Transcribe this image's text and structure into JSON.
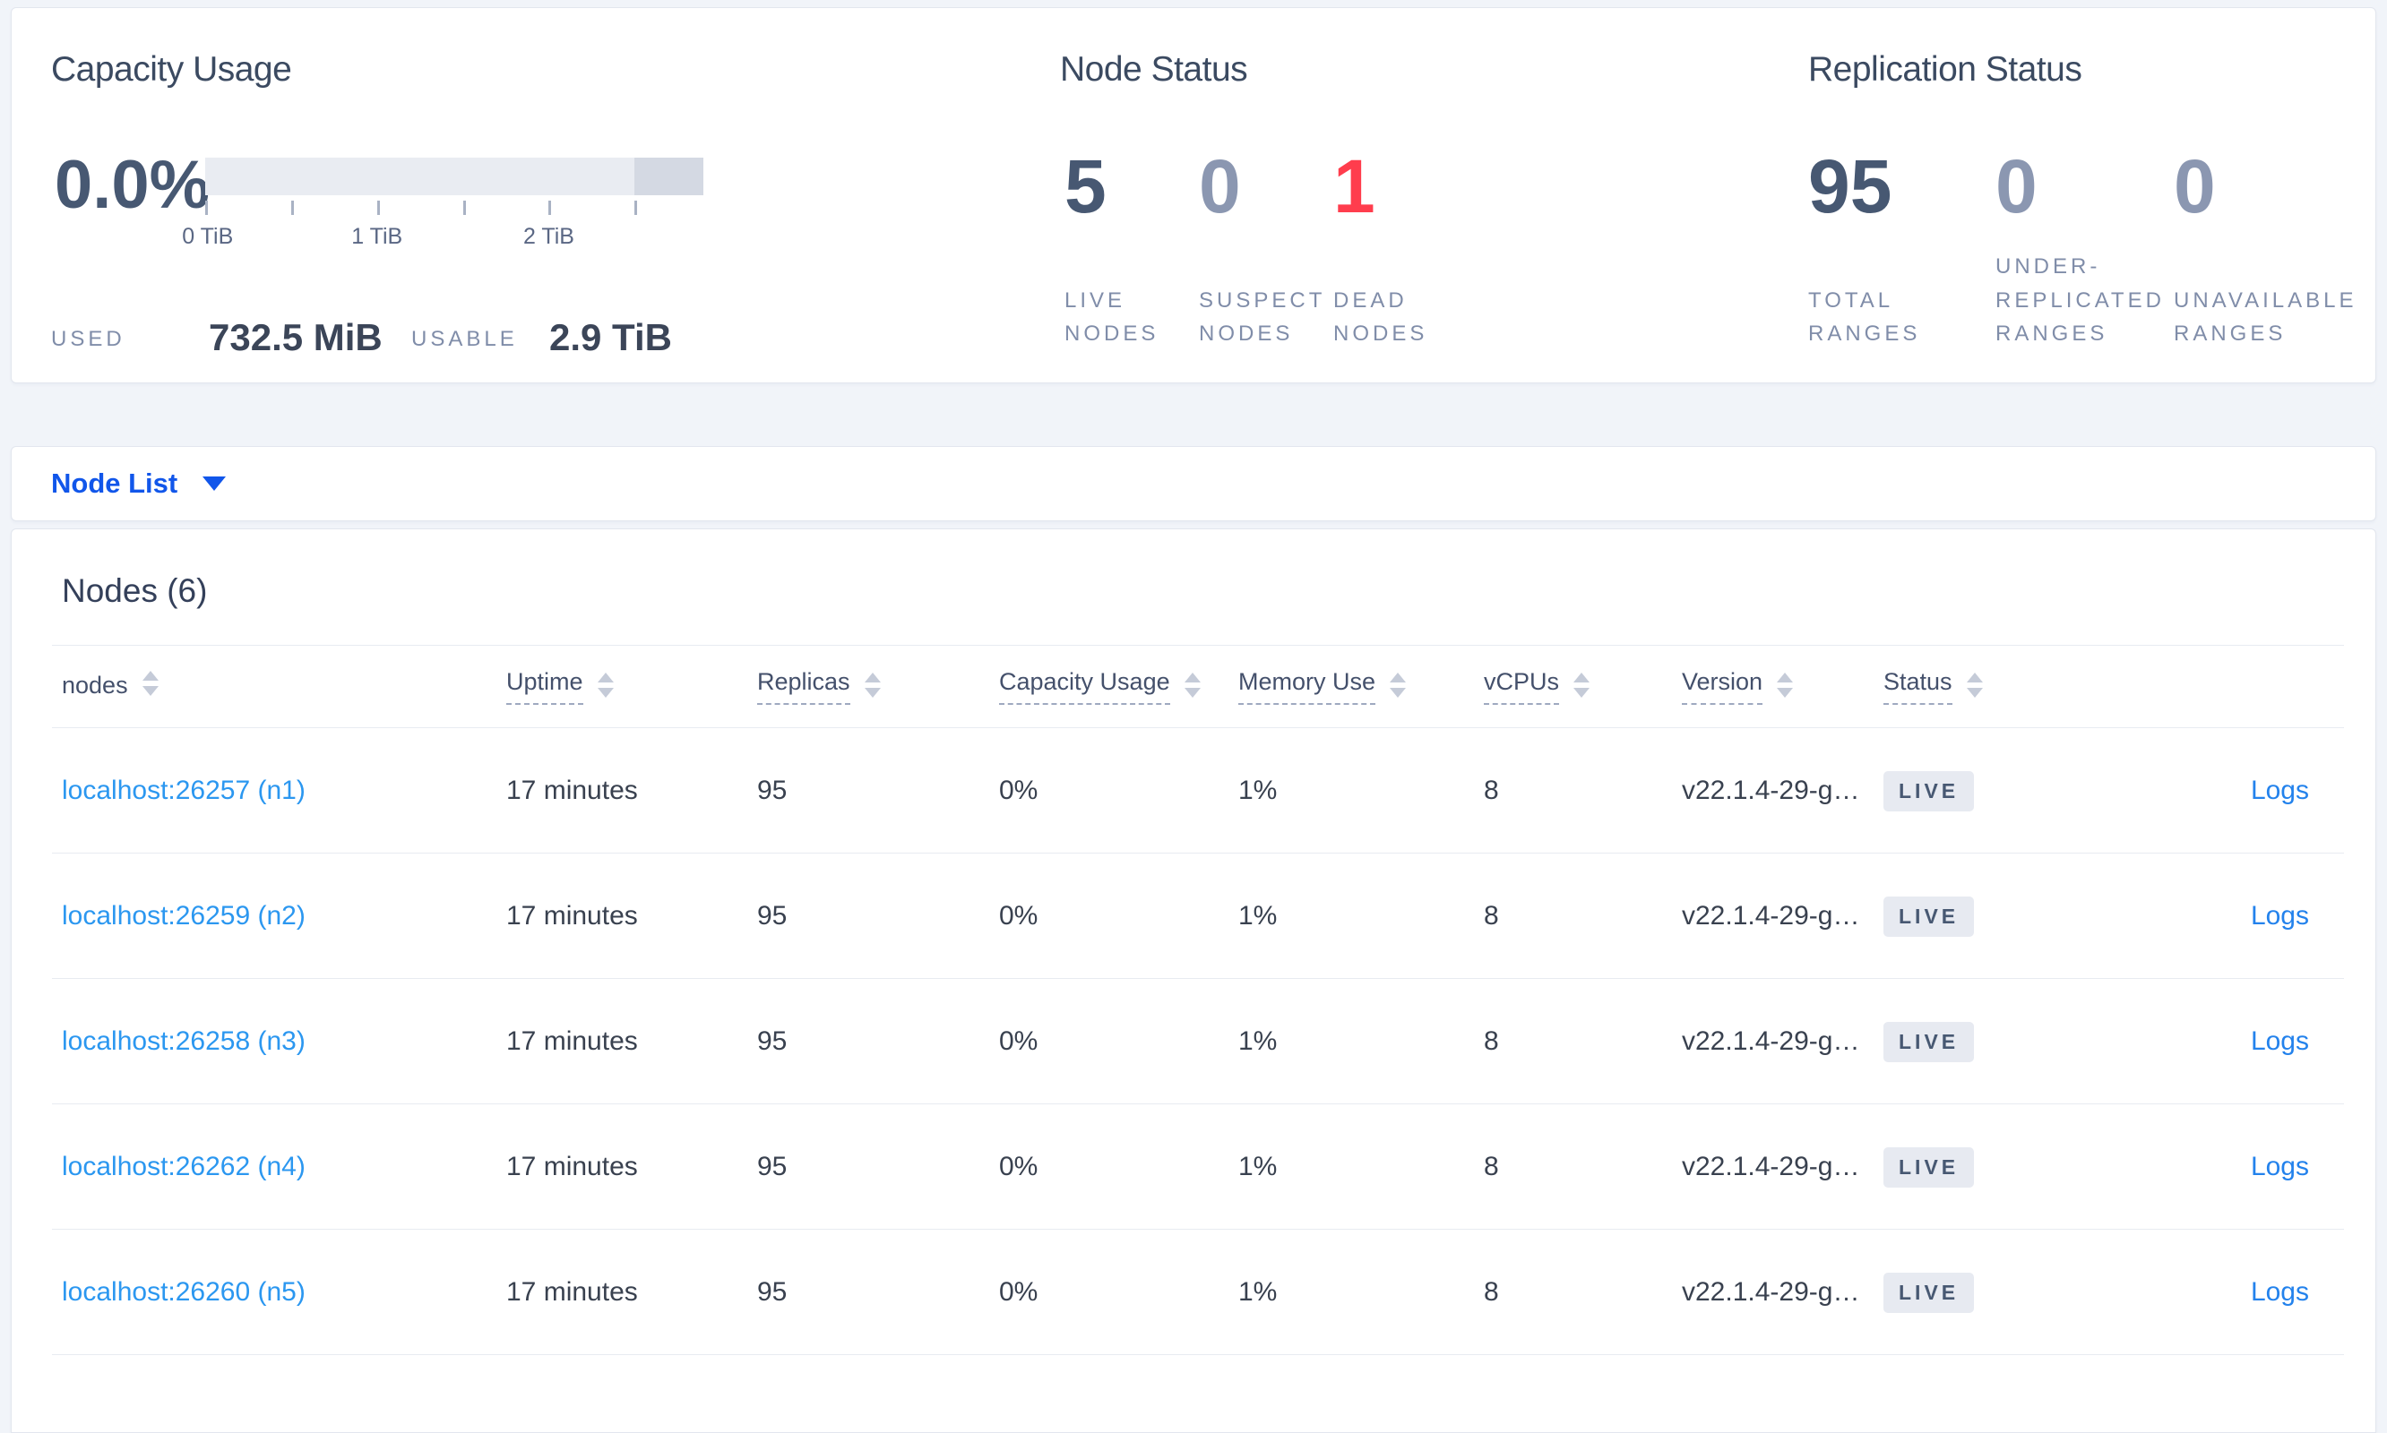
{
  "colors": {
    "accent_blue": "#1156ea",
    "node_link_blue": "#2b97f0",
    "logs_link_blue": "#2382ec",
    "danger_red": "#ff3d4d",
    "metric_primary": "#475872",
    "metric_muted": "#8b97b1",
    "badge_bg": "#e7eaf1"
  },
  "summary": {
    "capacity": {
      "title": "Capacity Usage",
      "percent": "0.0%",
      "tick_labels": [
        "0 TiB",
        "1 TiB",
        "2 TiB"
      ],
      "used_label": "USED",
      "used_value": "732.5 MiB",
      "usable_label": "USABLE",
      "usable_value": "2.9 TiB"
    },
    "node_status": {
      "title": "Node Status",
      "metrics": [
        {
          "value": "5",
          "label": "LIVE NODES"
        },
        {
          "value": "0",
          "label": "SUSPECT NODES"
        },
        {
          "value": "1",
          "label": "DEAD NODES"
        }
      ]
    },
    "replication": {
      "title": "Replication Status",
      "metrics": [
        {
          "value": "95",
          "label": "TOTAL RANGES"
        },
        {
          "value": "0",
          "label": "UNDER-REPLICATED RANGES"
        },
        {
          "value": "0",
          "label": "UNAVAILABLE RANGES"
        }
      ]
    }
  },
  "view_selector": {
    "label": "Node List"
  },
  "table": {
    "title": "Nodes (6)",
    "columns": [
      "nodes",
      "Uptime",
      "Replicas",
      "Capacity Usage",
      "Memory Use",
      "vCPUs",
      "Version",
      "Status"
    ],
    "rows": [
      {
        "node": "localhost:26257 (n1)",
        "uptime": "17 minutes",
        "replicas": "95",
        "capacity_usage": "0%",
        "memory_use": "1%",
        "vcpus": "8",
        "version": "v22.1.4-29-g…",
        "status": "LIVE",
        "logs": "Logs"
      },
      {
        "node": "localhost:26259 (n2)",
        "uptime": "17 minutes",
        "replicas": "95",
        "capacity_usage": "0%",
        "memory_use": "1%",
        "vcpus": "8",
        "version": "v22.1.4-29-g…",
        "status": "LIVE",
        "logs": "Logs"
      },
      {
        "node": "localhost:26258 (n3)",
        "uptime": "17 minutes",
        "replicas": "95",
        "capacity_usage": "0%",
        "memory_use": "1%",
        "vcpus": "8",
        "version": "v22.1.4-29-g…",
        "status": "LIVE",
        "logs": "Logs"
      },
      {
        "node": "localhost:26262 (n4)",
        "uptime": "17 minutes",
        "replicas": "95",
        "capacity_usage": "0%",
        "memory_use": "1%",
        "vcpus": "8",
        "version": "v22.1.4-29-g…",
        "status": "LIVE",
        "logs": "Logs"
      },
      {
        "node": "localhost:26260 (n5)",
        "uptime": "17 minutes",
        "replicas": "95",
        "capacity_usage": "0%",
        "memory_use": "1%",
        "vcpus": "8",
        "version": "v22.1.4-29-g…",
        "status": "LIVE",
        "logs": "Logs"
      }
    ]
  }
}
